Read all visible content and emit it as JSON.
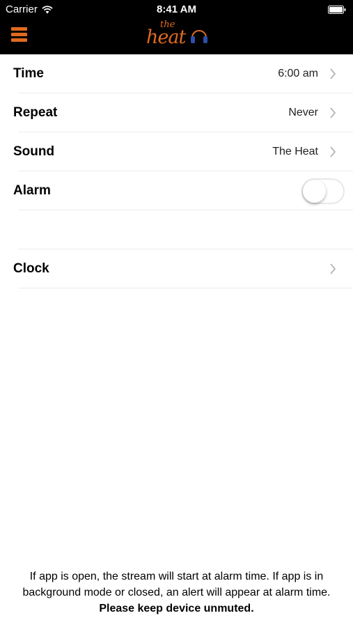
{
  "status_bar": {
    "carrier": "Carrier",
    "time": "8:41 AM"
  },
  "nav": {
    "logo_the": "the",
    "logo_heat": "heat",
    "accent_color": "#e06b1f"
  },
  "rows": [
    {
      "label": "Time",
      "value": "6:00 am"
    },
    {
      "label": "Repeat",
      "value": "Never"
    },
    {
      "label": "Sound",
      "value": "The Heat"
    },
    {
      "label": "Alarm",
      "toggle_on": false
    },
    {
      "label": "Clock",
      "value": ""
    }
  ],
  "footer": {
    "text": "If app is open, the stream will start at alarm time. If app is in background mode or closed, an alert will appear at alarm time.",
    "bold_text": "Please keep device unmuted."
  }
}
